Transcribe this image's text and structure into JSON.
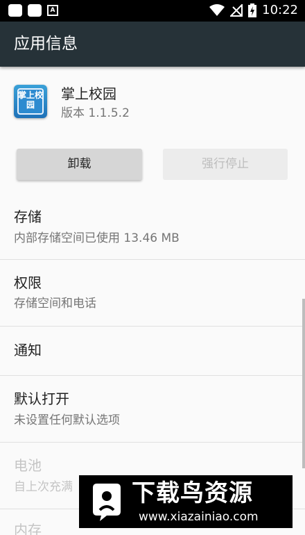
{
  "status_bar": {
    "time": "10:22",
    "icons": [
      "notification-icon",
      "notification-icon",
      "a-icon",
      "wifi-icon",
      "no-signal-icon",
      "battery-charging-icon"
    ]
  },
  "app_bar": {
    "title": "应用信息"
  },
  "app": {
    "name": "掌上校园",
    "version": "版本 1.1.5.2",
    "icon_text": "掌上校园"
  },
  "buttons": {
    "uninstall": "卸载",
    "force_stop": "强行停止"
  },
  "items": [
    {
      "title": "存储",
      "subtitle": "内部存储空间已使用 13.46 MB",
      "enabled": true
    },
    {
      "title": "权限",
      "subtitle": "存储空间和电话",
      "enabled": true
    },
    {
      "title": "通知",
      "subtitle": "",
      "enabled": true
    },
    {
      "title": "默认打开",
      "subtitle": "未设置任何默认选项",
      "enabled": true
    },
    {
      "title": "电池",
      "subtitle": "自上次充满",
      "enabled": false
    },
    {
      "title": "内存",
      "subtitle": "",
      "enabled": false
    }
  ],
  "watermark": {
    "title": "下载鸟资源",
    "url": "www.xiazainiao.com"
  },
  "colors": {
    "app_bar": "#263238",
    "status_bar": "#000000"
  }
}
